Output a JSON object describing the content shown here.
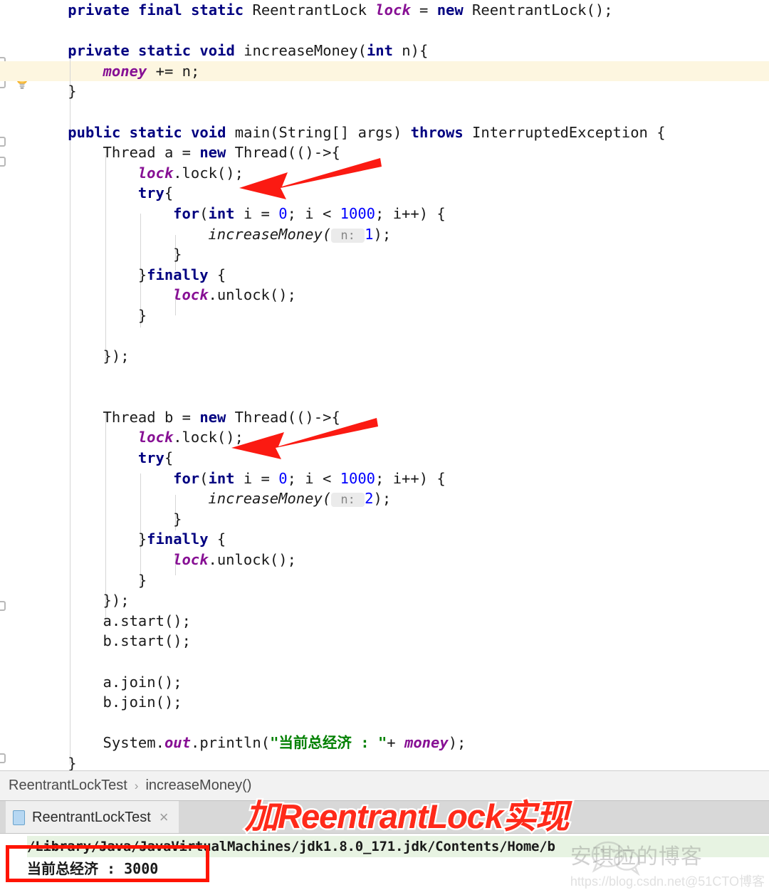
{
  "editor": {
    "language": "java",
    "current_line_index": 2,
    "colors": {
      "keyword": "#000080",
      "number": "#0000ff",
      "field": "#871094",
      "string": "#008000",
      "plain": "#1a1a1a",
      "current_line_bg": "#fdf6e0",
      "param_hint_bg": "#ebebeb"
    },
    "lines": [
      {
        "indent": 1,
        "tokens": [
          {
            "t": "private",
            "c": "kw"
          },
          {
            "t": " ",
            "c": "pln"
          },
          {
            "t": "final",
            "c": "kw"
          },
          {
            "t": " ",
            "c": "pln"
          },
          {
            "t": "static",
            "c": "kw"
          },
          {
            "t": " ReentrantLock ",
            "c": "pln"
          },
          {
            "t": "lock",
            "c": "fld"
          },
          {
            "t": " = ",
            "c": "pln"
          },
          {
            "t": "new",
            "c": "kw"
          },
          {
            "t": " ReentrantLock();",
            "c": "pln"
          }
        ]
      },
      {
        "indent": 0,
        "tokens": []
      },
      {
        "indent": 1,
        "tokens": [
          {
            "t": "private",
            "c": "kw"
          },
          {
            "t": " ",
            "c": "pln"
          },
          {
            "t": "static",
            "c": "kw"
          },
          {
            "t": " ",
            "c": "pln"
          },
          {
            "t": "void",
            "c": "kw"
          },
          {
            "t": " increaseMoney(",
            "c": "pln"
          },
          {
            "t": "int",
            "c": "kw"
          },
          {
            "t": " n){",
            "c": "pln"
          }
        ]
      },
      {
        "indent": 2,
        "highlight": true,
        "tokens": [
          {
            "t": "money",
            "c": "fld_i"
          },
          {
            "t": " += n;",
            "c": "pln"
          }
        ]
      },
      {
        "indent": 1,
        "tokens": [
          {
            "t": "}",
            "c": "pln"
          }
        ]
      },
      {
        "indent": 0,
        "tokens": []
      },
      {
        "indent": 1,
        "tokens": [
          {
            "t": "public",
            "c": "kw"
          },
          {
            "t": " ",
            "c": "pln"
          },
          {
            "t": "static",
            "c": "kw"
          },
          {
            "t": " ",
            "c": "pln"
          },
          {
            "t": "void",
            "c": "kw"
          },
          {
            "t": " main(String[] args) ",
            "c": "pln"
          },
          {
            "t": "throws",
            "c": "kw"
          },
          {
            "t": " InterruptedException {",
            "c": "pln"
          }
        ]
      },
      {
        "indent": 2,
        "tokens": [
          {
            "t": "Thread a = ",
            "c": "pln"
          },
          {
            "t": "new",
            "c": "kw"
          },
          {
            "t": " Thread(()->{",
            "c": "pln"
          }
        ]
      },
      {
        "indent": 3,
        "tokens": [
          {
            "t": "lock",
            "c": "fld"
          },
          {
            "t": ".lock();",
            "c": "pln"
          }
        ]
      },
      {
        "indent": 3,
        "tokens": [
          {
            "t": "try",
            "c": "kw"
          },
          {
            "t": "{",
            "c": "pln"
          }
        ]
      },
      {
        "indent": 4,
        "tokens": [
          {
            "t": "for",
            "c": "kw"
          },
          {
            "t": "(",
            "c": "pln"
          },
          {
            "t": "int",
            "c": "kw"
          },
          {
            "t": " i = ",
            "c": "pln"
          },
          {
            "t": "0",
            "c": "num"
          },
          {
            "t": "; i < ",
            "c": "pln"
          },
          {
            "t": "1000",
            "c": "num"
          },
          {
            "t": "; i++) {",
            "c": "pln"
          }
        ]
      },
      {
        "indent": 5,
        "tokens": [
          {
            "t": "increaseMoney(",
            "c": "mth"
          },
          {
            "t": " n: ",
            "c": "hint"
          },
          {
            "t": "1",
            "c": "num"
          },
          {
            "t": ");",
            "c": "pln"
          }
        ]
      },
      {
        "indent": 4,
        "tokens": [
          {
            "t": "}",
            "c": "pln"
          }
        ]
      },
      {
        "indent": 3,
        "tokens": [
          {
            "t": "}",
            "c": "pln"
          },
          {
            "t": "finally",
            "c": "kw"
          },
          {
            "t": " {",
            "c": "pln"
          }
        ]
      },
      {
        "indent": 4,
        "tokens": [
          {
            "t": "lock",
            "c": "fld"
          },
          {
            "t": ".unlock();",
            "c": "pln"
          }
        ]
      },
      {
        "indent": 3,
        "tokens": [
          {
            "t": "}",
            "c": "pln"
          }
        ]
      },
      {
        "indent": 0,
        "tokens": []
      },
      {
        "indent": 2,
        "tokens": [
          {
            "t": "});",
            "c": "pln"
          }
        ]
      },
      {
        "indent": 0,
        "tokens": []
      },
      {
        "indent": 0,
        "tokens": []
      },
      {
        "indent": 2,
        "tokens": [
          {
            "t": "Thread b = ",
            "c": "pln"
          },
          {
            "t": "new",
            "c": "kw"
          },
          {
            "t": " Thread(()->{",
            "c": "pln"
          }
        ]
      },
      {
        "indent": 3,
        "tokens": [
          {
            "t": "lock",
            "c": "fld"
          },
          {
            "t": ".lock();",
            "c": "pln"
          }
        ]
      },
      {
        "indent": 3,
        "tokens": [
          {
            "t": "try",
            "c": "kw"
          },
          {
            "t": "{",
            "c": "pln"
          }
        ]
      },
      {
        "indent": 4,
        "tokens": [
          {
            "t": "for",
            "c": "kw"
          },
          {
            "t": "(",
            "c": "pln"
          },
          {
            "t": "int",
            "c": "kw"
          },
          {
            "t": " i = ",
            "c": "pln"
          },
          {
            "t": "0",
            "c": "num"
          },
          {
            "t": "; i < ",
            "c": "pln"
          },
          {
            "t": "1000",
            "c": "num"
          },
          {
            "t": "; i++) {",
            "c": "pln"
          }
        ]
      },
      {
        "indent": 5,
        "tokens": [
          {
            "t": "increaseMoney(",
            "c": "mth"
          },
          {
            "t": " n: ",
            "c": "hint"
          },
          {
            "t": "2",
            "c": "num"
          },
          {
            "t": ");",
            "c": "pln"
          }
        ]
      },
      {
        "indent": 4,
        "tokens": [
          {
            "t": "}",
            "c": "pln"
          }
        ]
      },
      {
        "indent": 3,
        "tokens": [
          {
            "t": "}",
            "c": "pln"
          },
          {
            "t": "finally",
            "c": "kw"
          },
          {
            "t": " {",
            "c": "pln"
          }
        ]
      },
      {
        "indent": 4,
        "tokens": [
          {
            "t": "lock",
            "c": "fld"
          },
          {
            "t": ".unlock();",
            "c": "pln"
          }
        ]
      },
      {
        "indent": 3,
        "tokens": [
          {
            "t": "}",
            "c": "pln"
          }
        ]
      },
      {
        "indent": 2,
        "tokens": [
          {
            "t": "});",
            "c": "pln"
          }
        ]
      },
      {
        "indent": 2,
        "tokens": [
          {
            "t": "a.start();",
            "c": "pln"
          }
        ]
      },
      {
        "indent": 2,
        "tokens": [
          {
            "t": "b.start();",
            "c": "pln"
          }
        ]
      },
      {
        "indent": 0,
        "tokens": []
      },
      {
        "indent": 2,
        "tokens": [
          {
            "t": "a.join();",
            "c": "pln"
          }
        ]
      },
      {
        "indent": 2,
        "tokens": [
          {
            "t": "b.join();",
            "c": "pln"
          }
        ]
      },
      {
        "indent": 0,
        "tokens": []
      },
      {
        "indent": 2,
        "tokens": [
          {
            "t": "System.",
            "c": "pln"
          },
          {
            "t": "out",
            "c": "fld"
          },
          {
            "t": ".println(",
            "c": "pln"
          },
          {
            "t": "\"当前总经济 : \"",
            "c": "str"
          },
          {
            "t": "+ ",
            "c": "pln"
          },
          {
            "t": "money",
            "c": "fld_i"
          },
          {
            "t": ");",
            "c": "pln"
          }
        ]
      },
      {
        "indent": 1,
        "tokens": [
          {
            "t": "}",
            "c": "pln"
          }
        ]
      }
    ]
  },
  "gutter": {
    "bulb_icon": "lightbulb-icon",
    "fold_markers": 6
  },
  "breadcrumb": {
    "class_name": "ReentrantLockTest",
    "separator": "›",
    "method_name": "increaseMoney()"
  },
  "run_tab": {
    "label": "ReentrantLockTest",
    "close_icon": "×",
    "file_icon": "java-file-icon"
  },
  "console": {
    "command_line": "/Library/Java/JavaVirtualMachines/jdk1.8.0_171.jdk/Contents/Home/b",
    "output_line": "当前总经济 : 3000",
    "highlight_box_color": "#ff1400",
    "command_bg": "#e7f3e2"
  },
  "annotation": {
    "text": "加ReentrantLock实现",
    "color": "#ff2a1a"
  },
  "watermark": {
    "line1": "安琪拉的博客",
    "line2": "https://blog.csdn.net@51CTO博客"
  }
}
